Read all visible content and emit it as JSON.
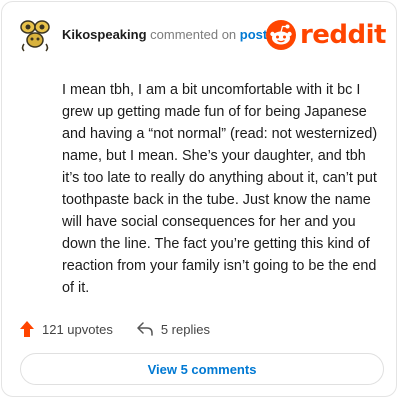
{
  "comment": {
    "username": "Kikospeaking",
    "action_text": "commented on",
    "post_link_label": "post",
    "logo_text": "reddit",
    "body": "I mean tbh, I am a bit uncomfortable with it bc I grew up getting made fun of for being Japanese and having a “not normal” (read: not westernized) name, but I mean. She’s your daughter, and tbh it’s too late to really do anything about it, can’t put toothpaste back in the tube. Just know the name will have social consequences for her and you down the line. The fact you’re getting this kind of reaction from your family isn’t going to be the end of it."
  },
  "actions": {
    "upvotes_label": "121 upvotes",
    "replies_label": "5 replies"
  },
  "footer": {
    "view_comments_label": "View 5 comments"
  },
  "icons": {
    "upvote": "upvote-arrow-icon",
    "reply": "reply-arrow-icon",
    "avatar": "avatar",
    "logo": "reddit-snoo-icon"
  },
  "colors": {
    "brand": "#ff4500",
    "link": "#0079d3",
    "muted": "#7c7c7c"
  }
}
